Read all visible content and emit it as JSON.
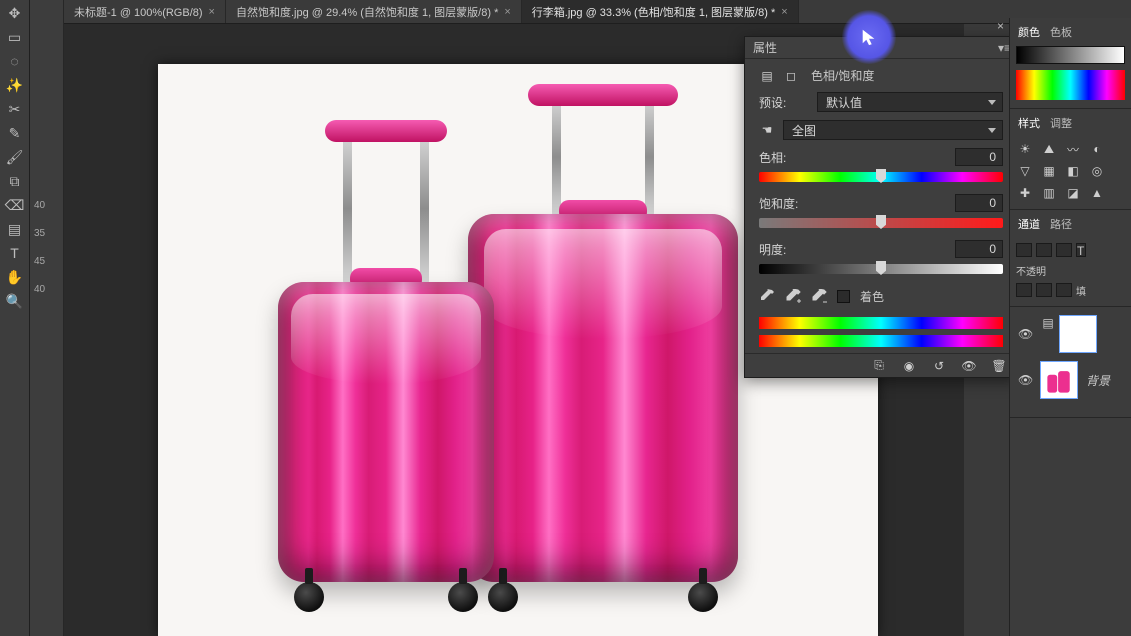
{
  "tabs": [
    {
      "label": "未标题-1 @ 100%(RGB/8)",
      "active": false
    },
    {
      "label": "自然饱和度.jpg @ 29.4% (自然饱和度 1, 图层蒙版/8) *",
      "active": false
    },
    {
      "label": "行李箱.jpg @ 33.3% (色相/饱和度 1, 图层蒙版/8) *",
      "active": true
    }
  ],
  "properties_panel": {
    "title": "属性",
    "adjustment_name": "色相/饱和度",
    "preset_label": "预设:",
    "preset_value": "默认值",
    "range_label": "全图",
    "hue": {
      "label": "色相:",
      "value": "0"
    },
    "saturation": {
      "label": "饱和度:",
      "value": "0"
    },
    "lightness": {
      "label": "明度:",
      "value": "0"
    },
    "colorize_label": "着色"
  },
  "right_dock": {
    "color_tab": "颜色",
    "swatches_tab": "色板",
    "styles_tab": "样式",
    "adjust_tab": "调整",
    "channels_tab": "通道",
    "paths_tab": "路径",
    "opacity_label": "不透明",
    "fill_label": "填",
    "background_layer_name": "背景"
  },
  "side_measure": [
    "40",
    "35",
    "45",
    "40"
  ]
}
